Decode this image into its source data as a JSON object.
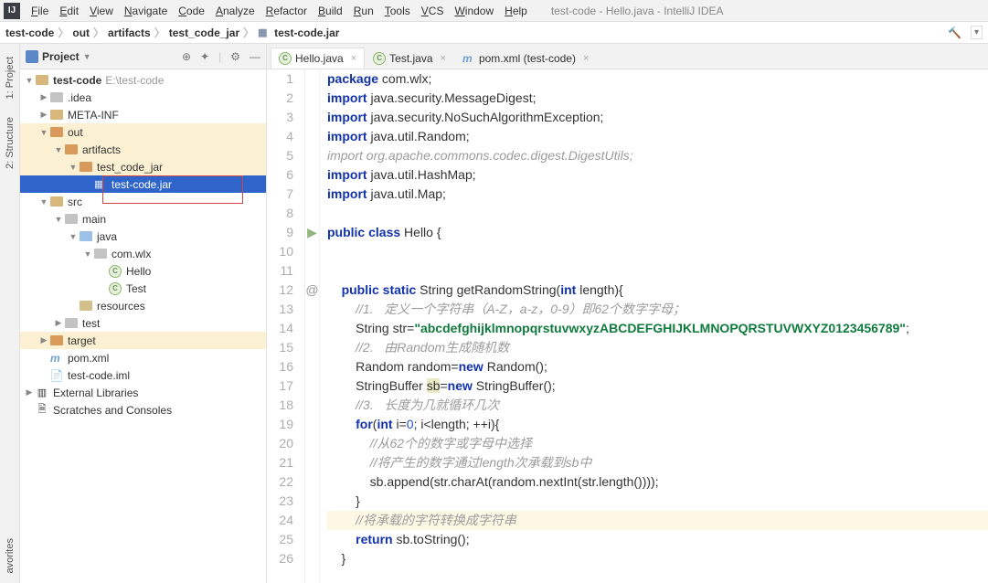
{
  "menu": {
    "items": [
      "File",
      "Edit",
      "View",
      "Navigate",
      "Code",
      "Analyze",
      "Refactor",
      "Build",
      "Run",
      "Tools",
      "VCS",
      "Window",
      "Help"
    ],
    "title": "test-code - Hello.java - IntelliJ IDEA"
  },
  "breadcrumb": [
    "test-code",
    "out",
    "artifacts",
    "test_code_jar",
    "test-code.jar"
  ],
  "leftstrip": [
    "1: Project",
    "2: Structure",
    "avorites"
  ],
  "project_panel": {
    "label": "Project"
  },
  "tree": {
    "root": {
      "label": "test-code",
      "path": "E:\\test-code"
    },
    "idea": ".idea",
    "metainf": "META-INF",
    "out": "out",
    "artifacts": "artifacts",
    "tcjar_dir": "test_code_jar",
    "tcjar": "test-code.jar",
    "src": "src",
    "main": "main",
    "java": "java",
    "comwlx": "com.wlx",
    "hello": "Hello",
    "test": "Test",
    "resources": "resources",
    "test_dir": "test",
    "target": "target",
    "pom": "pom.xml",
    "iml": "test-code.iml",
    "extlib": "External Libraries",
    "scratches": "Scratches and Consoles"
  },
  "tabs": [
    {
      "label": "Hello.java",
      "icon": "java",
      "active": true
    },
    {
      "label": "Test.java",
      "icon": "java",
      "active": false
    },
    {
      "label": "pom.xml (test-code)",
      "icon": "m",
      "active": false
    }
  ],
  "code": {
    "lines": [
      {
        "n": 1,
        "kind": "code",
        "html": "<span class='kw'>package</span> com.wlx;"
      },
      {
        "n": 2,
        "kind": "code",
        "html": "<span class='kw'>import</span> java.security.MessageDigest;"
      },
      {
        "n": 3,
        "kind": "code",
        "html": "<span class='kw'>import</span> java.security.NoSuchAlgorithmException;"
      },
      {
        "n": 4,
        "kind": "code",
        "html": "<span class='kw'>import</span> java.util.Random;"
      },
      {
        "n": 5,
        "kind": "code",
        "html": "<span class='kw cmt' style='color:#9c9c9c;font-weight:normal'>import</span><span class='cmt'> org.apache.commons.codec.digest.DigestUtils;</span>"
      },
      {
        "n": 6,
        "kind": "code",
        "html": "<span class='kw'>import</span> java.util.HashMap;"
      },
      {
        "n": 7,
        "kind": "code",
        "html": "<span class='kw'>import</span> java.util.Map;"
      },
      {
        "n": 8,
        "kind": "blank",
        "html": ""
      },
      {
        "n": 9,
        "kind": "code",
        "mark": "▶",
        "html": "<span class='kw'>public class</span> Hello {"
      },
      {
        "n": 10,
        "kind": "blank",
        "html": ""
      },
      {
        "n": 11,
        "kind": "blank",
        "html": ""
      },
      {
        "n": 12,
        "kind": "code",
        "mark": "@",
        "html": "    <span class='kw'>public static</span> String getRandomString(<span class='kw'>int</span> length){"
      },
      {
        "n": 13,
        "kind": "code",
        "html": "        <span class='cmt'>//1.   定义一个字符串（A-Z，a-z，0-9）即62个数字字母；</span>"
      },
      {
        "n": 14,
        "kind": "code",
        "html": "        String str=<span class='str'>\"abcdefghijklmnopqrstuvwxyzABCDEFGHIJKLMNOPQRSTUVWXYZ0123456789\"</span>;"
      },
      {
        "n": 15,
        "kind": "code",
        "html": "        <span class='cmt'>//2.   由Random生成随机数</span>"
      },
      {
        "n": 16,
        "kind": "code",
        "html": "        Random random=<span class='kw'>new</span> Random();"
      },
      {
        "n": 17,
        "kind": "code",
        "html": "        StringBuffer <span class='warn'>sb</span>=<span class='kw'>new</span> StringBuffer();"
      },
      {
        "n": 18,
        "kind": "code",
        "html": "        <span class='cmt'>//3.   长度为几就循环几次</span>"
      },
      {
        "n": 19,
        "kind": "code",
        "html": "        <span class='kw'>for</span>(<span class='kw'>int</span> i=<span style='color:#2050d0'>0</span>; i&lt;length; ++i){"
      },
      {
        "n": 20,
        "kind": "code",
        "html": "            <span class='cmt'>//从62个的数字或字母中选择</span>"
      },
      {
        "n": 21,
        "kind": "code",
        "html": "            <span class='cmt'>//将产生的数字通过length次承载到sb中</span>"
      },
      {
        "n": 22,
        "kind": "code",
        "html": "            sb.append(str.charAt(random.nextInt(str.length())));"
      },
      {
        "n": 23,
        "kind": "code",
        "html": "        }"
      },
      {
        "n": 24,
        "kind": "hl",
        "html": "        <span class='cmt'>//将承载的字符转换成字符串</span>"
      },
      {
        "n": 25,
        "kind": "code",
        "html": "        <span class='kw'>return</span> sb.toString();"
      },
      {
        "n": 26,
        "kind": "code",
        "html": "    }"
      }
    ]
  }
}
